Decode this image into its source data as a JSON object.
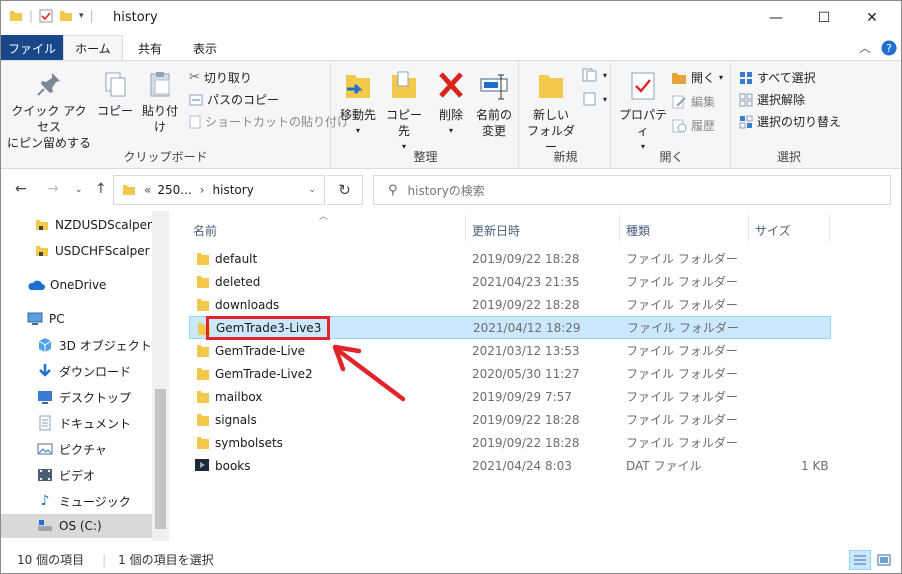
{
  "window": {
    "title": "history",
    "minimize": "—",
    "maximize": "☐",
    "close": "✕"
  },
  "tabs": {
    "file": "ファイル",
    "home": "ホーム",
    "share": "共有",
    "view": "表示"
  },
  "ribbon": {
    "clipboard": {
      "label": "クリップボード",
      "pin_quick_line1": "クイック アクセス",
      "pin_quick_line2": "にピン留めする",
      "copy": "コピー",
      "paste": "貼り付け",
      "cut": "切り取り",
      "copy_path": "パスのコピー",
      "paste_shortcut": "ショートカットの貼り付け"
    },
    "organize": {
      "label": "整理",
      "move_to": "移動先",
      "copy_to": "コピー先",
      "delete": "削除",
      "rename_line1": "名前の",
      "rename_line2": "変更"
    },
    "new": {
      "label": "新規",
      "new_folder_line1": "新しい",
      "new_folder_line2": "フォルダー"
    },
    "open": {
      "label": "開く",
      "properties": "プロパティ",
      "open": "開く",
      "edit": "編集",
      "history": "履歴"
    },
    "select": {
      "label": "選択",
      "select_all": "すべて選択",
      "select_none": "選択解除",
      "invert": "選択の切り替え"
    }
  },
  "address": {
    "path_prefix": "«",
    "path_parent": "250...",
    "path_sep": "›",
    "path_current": "history",
    "search_placeholder": "historyの検索"
  },
  "sidebar": {
    "items": [
      {
        "label": "NZDUSDScalper"
      },
      {
        "label": "USDCHFScalper"
      },
      {
        "label": "OneDrive"
      },
      {
        "label": "PC"
      },
      {
        "label": "3D オブジェクト"
      },
      {
        "label": "ダウンロード"
      },
      {
        "label": "デスクトップ"
      },
      {
        "label": "ドキュメント"
      },
      {
        "label": "ピクチャ"
      },
      {
        "label": "ビデオ"
      },
      {
        "label": "ミュージック"
      },
      {
        "label": "OS (C:)"
      }
    ]
  },
  "columns": {
    "name": "名前",
    "date": "更新日時",
    "type": "種類",
    "size": "サイズ"
  },
  "files": [
    {
      "name": "default",
      "date": "2019/09/22 18:28",
      "type": "ファイル フォルダー",
      "size": ""
    },
    {
      "name": "deleted",
      "date": "2021/04/23 21:35",
      "type": "ファイル フォルダー",
      "size": ""
    },
    {
      "name": "downloads",
      "date": "2019/09/22 18:28",
      "type": "ファイル フォルダー",
      "size": ""
    },
    {
      "name": "GemTrade3-Live3",
      "date": "2021/04/12 18:29",
      "type": "ファイル フォルダー",
      "size": ""
    },
    {
      "name": "GemTrade-Live",
      "date": "2021/03/12 13:53",
      "type": "ファイル フォルダー",
      "size": ""
    },
    {
      "name": "GemTrade-Live2",
      "date": "2020/05/30 11:27",
      "type": "ファイル フォルダー",
      "size": ""
    },
    {
      "name": "mailbox",
      "date": "2019/09/29 7:57",
      "type": "ファイル フォルダー",
      "size": ""
    },
    {
      "name": "signals",
      "date": "2019/09/22 18:28",
      "type": "ファイル フォルダー",
      "size": ""
    },
    {
      "name": "symbolsets",
      "date": "2019/09/22 18:28",
      "type": "ファイル フォルダー",
      "size": ""
    },
    {
      "name": "books",
      "date": "2021/04/24 8:03",
      "type": "DAT ファイル",
      "size": "1 KB"
    }
  ],
  "status": {
    "item_count": "10 個の項目",
    "selected_count": "1 個の項目を選択"
  },
  "colors": {
    "accent": "#19478a",
    "selection": "#cce8ff",
    "highlight": "#e0242c",
    "folder": "#f2c94c"
  }
}
